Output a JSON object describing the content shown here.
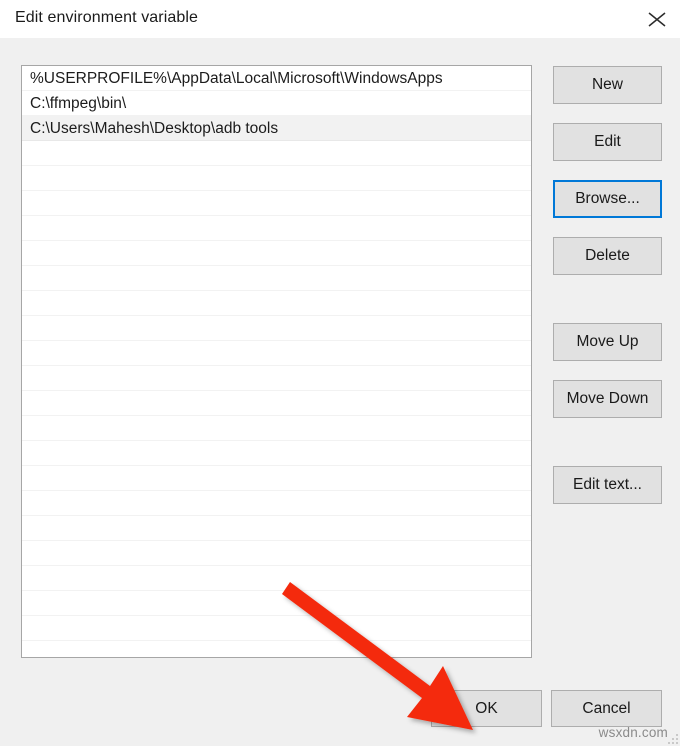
{
  "window": {
    "title": "Edit environment variable",
    "close_icon": "close-icon"
  },
  "listbox": {
    "entries": [
      "%USERPROFILE%\\AppData\\Local\\Microsoft\\WindowsApps",
      "C:\\ffmpeg\\bin\\",
      "C:\\Users\\Mahesh\\Desktop\\adb tools"
    ],
    "selected_index": 2,
    "empty_row_count": 20
  },
  "side_buttons": {
    "new": "New",
    "edit": "Edit",
    "browse": "Browse...",
    "delete": "Delete",
    "move_up": "Move Up",
    "move_down": "Move Down",
    "edit_text": "Edit text...",
    "focused": "browse"
  },
  "bottom_buttons": {
    "ok": "OK",
    "cancel": "Cancel"
  },
  "annotation": {
    "arrow_color": "#F42A10",
    "arrow_target": "OK"
  },
  "watermark": {
    "text": "wsxdn.com"
  },
  "colors": {
    "accent_focus": "#0078D7",
    "button_face": "#E1E1E1",
    "button_border": "#ADADAD",
    "dialog_background": "#F0F0F0",
    "list_background": "#FFFFFF",
    "list_selected": "#F2F2F2",
    "text": "#1A1A1A",
    "arrow_red": "#F42A10"
  }
}
